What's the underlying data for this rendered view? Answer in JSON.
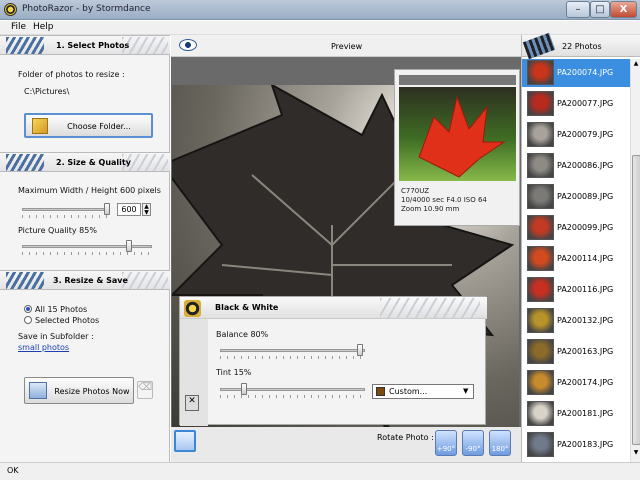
{
  "window": {
    "title": "PhotoRazor - by Stormdance",
    "minimize": "–",
    "maximize": "□",
    "close": "X"
  },
  "menu": {
    "file": "File",
    "help": "Help"
  },
  "left": {
    "sec1": {
      "title": "1. Select Photos",
      "folder_label": "Folder of photos to resize :",
      "folder_path": "C:\\Pictures\\",
      "choose_button": "Choose Folder..."
    },
    "sec2": {
      "title": "2. Size & Quality",
      "size_label": "Maximum Width / Height 600 pixels",
      "size_value": "600",
      "quality_label": "Picture Quality 85%"
    },
    "sec3": {
      "title": "3. Resize & Save",
      "opt_all": "All 15 Photos",
      "opt_selected": "Selected Photos",
      "subfolder_label": "Save in Subfolder :",
      "subfolder_link": "small photos",
      "resize_button": "Resize Photos Now"
    }
  },
  "center": {
    "preview_label": "Preview",
    "info": {
      "camera": "C770UZ",
      "exposure": "10/4000 sec  F4.0  ISO 64",
      "zoom": "Zoom 10.90 mm"
    },
    "bw": {
      "title": "Black & White",
      "balance_label": "Balance 80%",
      "tint_label": "Tint 15%",
      "custom_option": "Custom..."
    },
    "rotate_label": "Rotate Photo :",
    "rotate": [
      "+90°",
      "-90°",
      "180°"
    ]
  },
  "right": {
    "count_label": "22 Photos",
    "thumbs": [
      "PA200074.JPG",
      "PA200077.JPG",
      "PA200079.JPG",
      "PA200086.JPG",
      "PA200089.JPG",
      "PA200099.JPG",
      "PA200114.JPG",
      "PA200116.JPG",
      "PA200132.JPG",
      "PA200163.JPG",
      "PA200174.JPG",
      "PA200181.JPG",
      "PA200183.JPG"
    ],
    "selected_index": 0
  },
  "status": "OK",
  "colors": {
    "selection": "#3b8ee0",
    "link": "#1a3fb5"
  }
}
